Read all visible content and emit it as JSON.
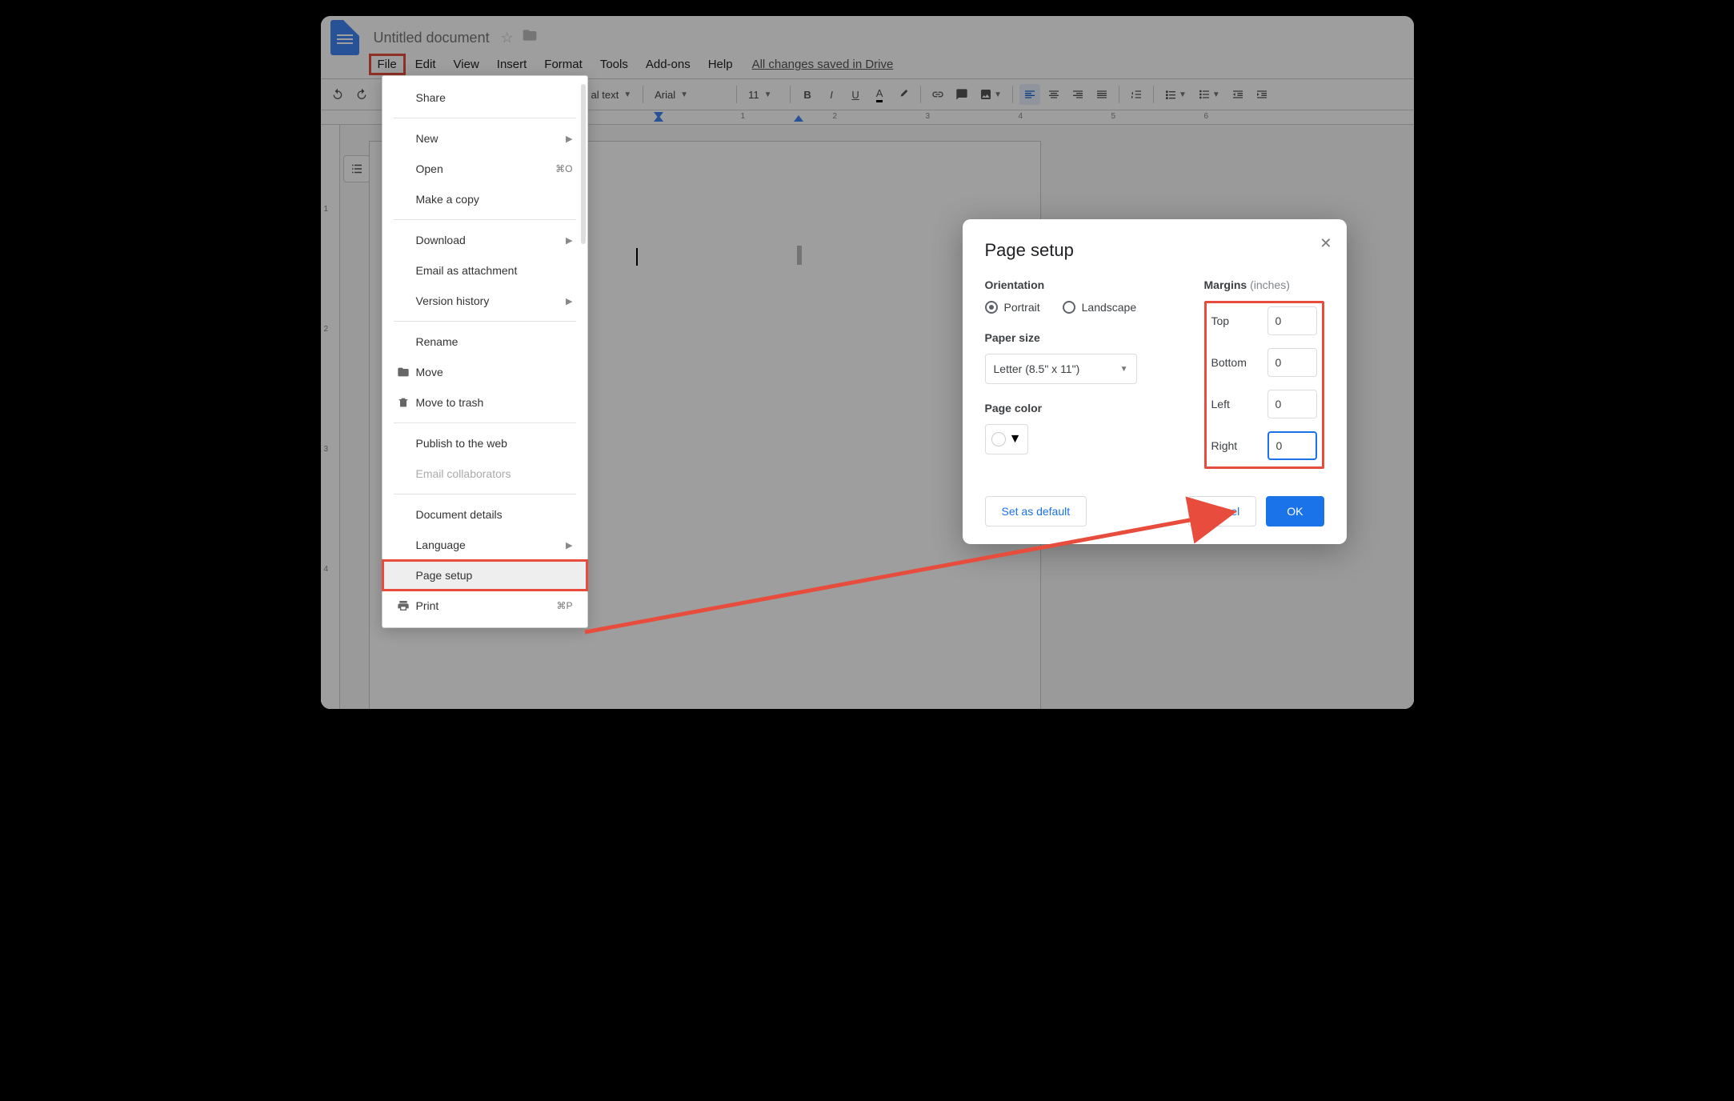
{
  "doc": {
    "title": "Untitled document"
  },
  "menubar": {
    "file": "File",
    "edit": "Edit",
    "view": "View",
    "insert": "Insert",
    "format": "Format",
    "tools": "Tools",
    "addons": "Add-ons",
    "help": "Help",
    "saved": "All changes saved in Drive"
  },
  "toolbar": {
    "style_label": "al text",
    "font_label": "Arial",
    "font_size": "11"
  },
  "ruler": {
    "ticks": [
      "1",
      "2",
      "3",
      "4",
      "5",
      "6"
    ]
  },
  "vruler": {
    "ticks": [
      "1",
      "2",
      "3",
      "4"
    ]
  },
  "file_menu": {
    "share": "Share",
    "new": "New",
    "open": "Open",
    "open_shortcut": "⌘O",
    "make_copy": "Make a copy",
    "download": "Download",
    "email_attachment": "Email as attachment",
    "version_history": "Version history",
    "rename": "Rename",
    "move": "Move",
    "move_trash": "Move to trash",
    "publish": "Publish to the web",
    "email_collab": "Email collaborators",
    "doc_details": "Document details",
    "language": "Language",
    "page_setup": "Page setup",
    "print": "Print",
    "print_shortcut": "⌘P"
  },
  "dialog": {
    "title": "Page setup",
    "orientation_label": "Orientation",
    "portrait": "Portrait",
    "landscape": "Landscape",
    "paper_size_label": "Paper size",
    "paper_size_value": "Letter (8.5\" x 11\")",
    "page_color_label": "Page color",
    "margins_label": "Margins",
    "margins_unit": "(inches)",
    "top": "Top",
    "top_val": "0",
    "bottom": "Bottom",
    "bottom_val": "0",
    "left": "Left",
    "left_val": "0",
    "right": "Right",
    "right_val": "0",
    "set_default": "Set as default",
    "cancel": "Cancel",
    "ok": "OK"
  }
}
